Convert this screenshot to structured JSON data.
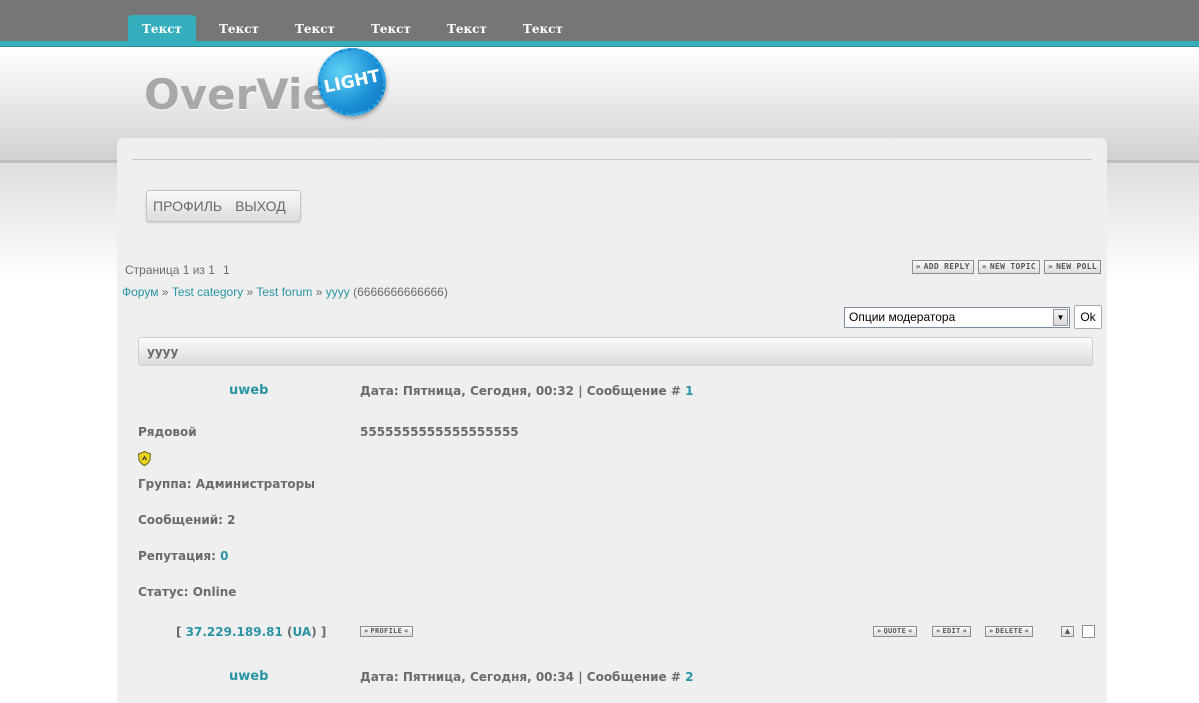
{
  "tabs": [
    "Текст",
    "Текст",
    "Текст",
    "Текст",
    "Текст",
    "Текст"
  ],
  "logo": {
    "text": "OverView",
    "badge": "LIGHT"
  },
  "userbox": {
    "profile": "Профиль",
    "logout": "Выход"
  },
  "pager": {
    "label": "Страница 1 из 1",
    "page": "1"
  },
  "actions": {
    "add_reply": "ADD REPLY",
    "new_topic": "NEW TOPIC",
    "new_poll": "NEW POLL"
  },
  "breadcrumbs": {
    "forum": "Форум",
    "sep": "»",
    "category": "Test category",
    "subforum": "Test forum",
    "topic": "yyyy",
    "topic_desc": "(6666666666666)"
  },
  "moderator": {
    "selected": "Опции модератора",
    "ok": "Ok"
  },
  "topic_title": "yyyy",
  "posts": [
    {
      "username": "uweb",
      "date_label": "Дата: Пятница, Сегодня, 00:32 | Сообщение #",
      "post_number": "1",
      "rank": "Рядовой",
      "message": "5555555555555555555",
      "group_label": "Группа: Администраторы",
      "messages_label": "Сообщений: 2",
      "rep_label": "Репутация:",
      "rep_value": "0",
      "status_label": "Статус: Online",
      "ip": "37.229.189.81",
      "country": "UA",
      "buttons": {
        "profile": "PROFILE",
        "quote": "QUOTE",
        "edit": "EDIT",
        "delete": "DELETE",
        "up": "▲"
      }
    },
    {
      "username": "uweb",
      "date_label": "Дата: Пятница, Сегодня, 00:34 | Сообщение #",
      "post_number": "2"
    }
  ],
  "colors": {
    "accent": "#35aebd",
    "link": "#2a94a5",
    "topbar": "#767676",
    "panel": "#efefef"
  }
}
